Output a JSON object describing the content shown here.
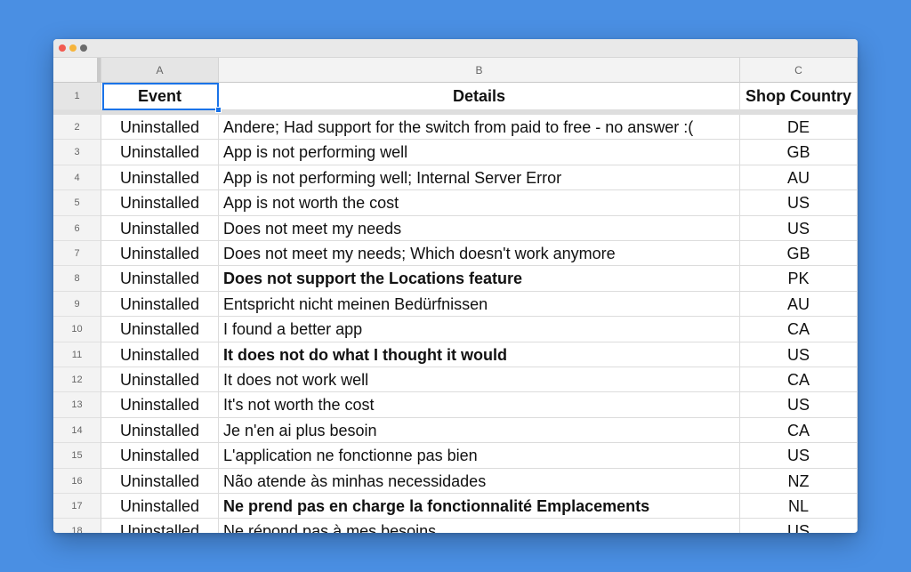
{
  "window": {
    "controls": [
      "close",
      "minimize",
      "other"
    ]
  },
  "sheet": {
    "columns": [
      "A",
      "B",
      "C"
    ],
    "header_row_number": "1",
    "headers": [
      "Event",
      "Details",
      "Shop Country"
    ],
    "rows": [
      {
        "num": "2",
        "event": "Uninstalled",
        "details": "Andere; Had support for the switch from paid to free - no answer :(",
        "country": "DE",
        "bold": false
      },
      {
        "num": "3",
        "event": "Uninstalled",
        "details": "App is not performing well",
        "country": "GB",
        "bold": false
      },
      {
        "num": "4",
        "event": "Uninstalled",
        "details": "App is not performing well; Internal Server Error",
        "country": "AU",
        "bold": false
      },
      {
        "num": "5",
        "event": "Uninstalled",
        "details": "App is not worth the cost",
        "country": "US",
        "bold": false
      },
      {
        "num": "6",
        "event": "Uninstalled",
        "details": "Does not meet my needs",
        "country": "US",
        "bold": false
      },
      {
        "num": "7",
        "event": "Uninstalled",
        "details": "Does not meet my needs; Which doesn't work anymore",
        "country": "GB",
        "bold": false
      },
      {
        "num": "8",
        "event": "Uninstalled",
        "details": "Does not support the Locations feature",
        "country": "PK",
        "bold": true
      },
      {
        "num": "9",
        "event": "Uninstalled",
        "details": "Entspricht nicht meinen Bedürfnissen",
        "country": "AU",
        "bold": false
      },
      {
        "num": "10",
        "event": "Uninstalled",
        "details": "I found a better app",
        "country": "CA",
        "bold": false
      },
      {
        "num": "11",
        "event": "Uninstalled",
        "details": "It does not do what I thought it would",
        "country": "US",
        "bold": true
      },
      {
        "num": "12",
        "event": "Uninstalled",
        "details": "It does not work well",
        "country": "CA",
        "bold": false
      },
      {
        "num": "13",
        "event": "Uninstalled",
        "details": "It's not worth the cost",
        "country": "US",
        "bold": false
      },
      {
        "num": "14",
        "event": "Uninstalled",
        "details": "Je n'en ai plus besoin",
        "country": "CA",
        "bold": false
      },
      {
        "num": "15",
        "event": "Uninstalled",
        "details": "L'application ne fonctionne pas bien",
        "country": "US",
        "bold": false
      },
      {
        "num": "16",
        "event": "Uninstalled",
        "details": "Não atende às minhas necessidades",
        "country": "NZ",
        "bold": false
      },
      {
        "num": "17",
        "event": "Uninstalled",
        "details": "Ne prend pas en charge la fonctionnalité Emplacements",
        "country": "NL",
        "bold": true
      },
      {
        "num": "18",
        "event": "Uninstalled",
        "details": "Ne répond pas à mes besoins",
        "country": "US",
        "bold": false
      }
    ]
  },
  "colors": {
    "background": "#4a8fe3",
    "selection": "#1a73e8"
  }
}
